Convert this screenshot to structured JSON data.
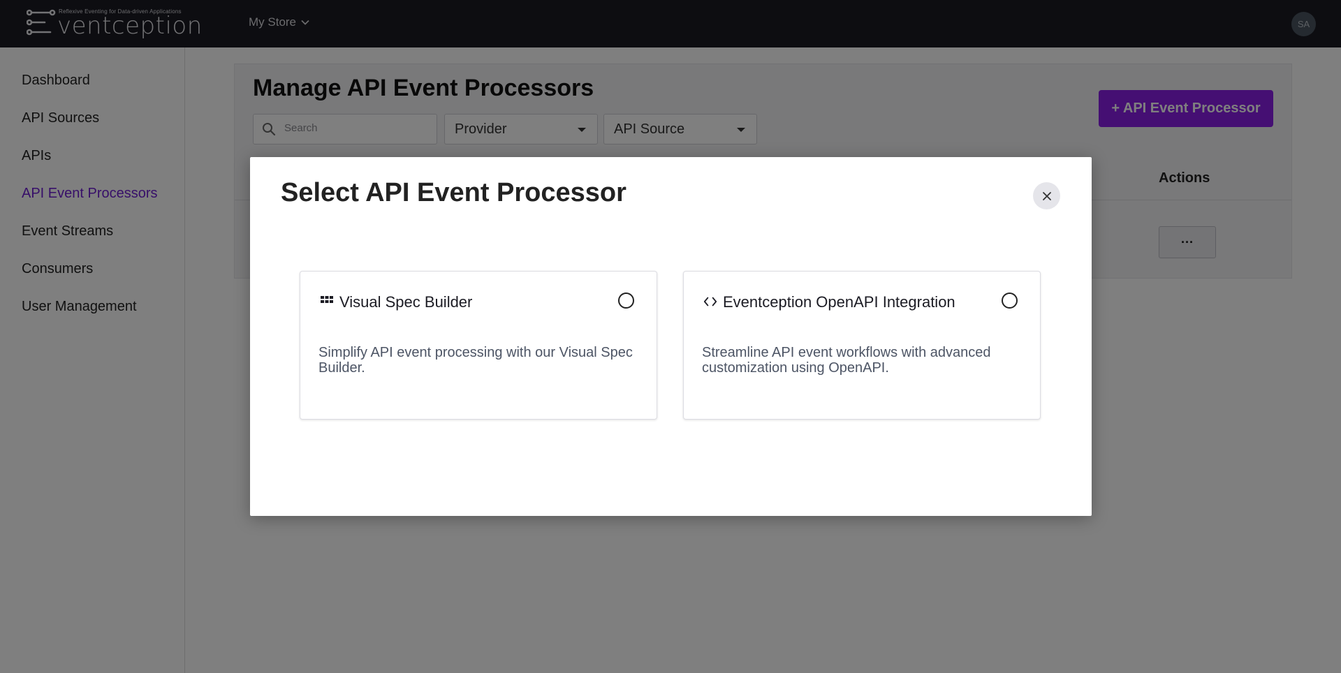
{
  "header": {
    "logo_tagline": "Reflexive Eventing for Data-driven Applications",
    "logo_wordmark": "ventception",
    "store_label": "My Store",
    "avatar_initials": "SA"
  },
  "sidebar": {
    "items": [
      {
        "label": "Dashboard",
        "active": false
      },
      {
        "label": "API Sources",
        "active": false
      },
      {
        "label": "APIs",
        "active": false
      },
      {
        "label": "API Event Processors",
        "active": true
      },
      {
        "label": "Event Streams",
        "active": false
      },
      {
        "label": "Consumers",
        "active": false
      },
      {
        "label": "User Management",
        "active": false
      }
    ]
  },
  "page": {
    "title": "Manage API Event Processors",
    "search_placeholder": "Search",
    "filters": {
      "provider": "Provider",
      "api_source": "API Source"
    },
    "add_button_label": "+ API Event Processor",
    "table": {
      "actions_header": "Actions",
      "row_action_label": "···"
    }
  },
  "modal": {
    "title": "Select API Event Processor",
    "options": [
      {
        "icon": "grid-icon",
        "title": "Visual Spec Builder",
        "description": "Simplify API event processing with our Visual Spec Builder.",
        "selected": false
      },
      {
        "icon": "code-icon",
        "title": "Eventception OpenAPI Integration",
        "description": "Streamline API event workflows with advanced customization using OpenAPI.",
        "selected": false
      }
    ]
  },
  "colors": {
    "accent": "#8b1fe6",
    "active_nav": "#6f1fd2",
    "topbar": "#1b1a23"
  }
}
